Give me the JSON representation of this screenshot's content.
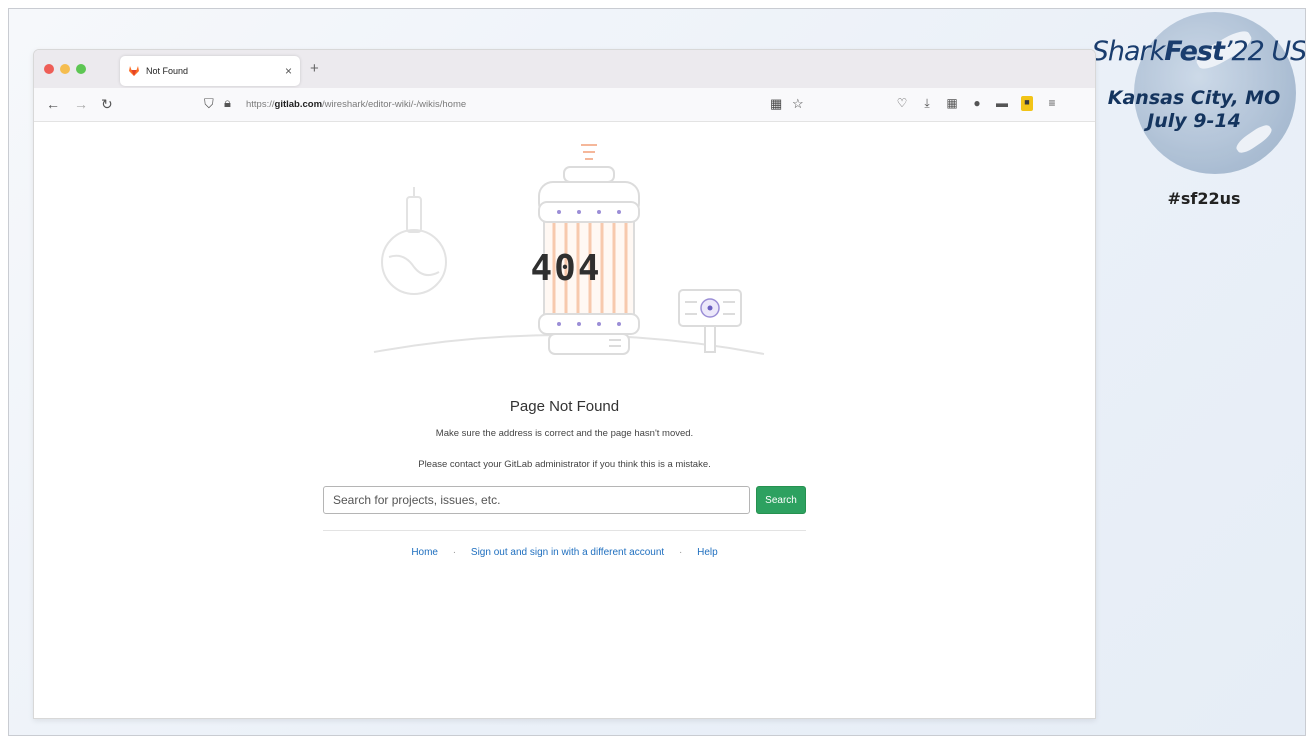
{
  "event": {
    "title_part1": "Shark",
    "title_part2": "Fest",
    "title_part3": "’22 US",
    "city": "Kansas City, MO",
    "dates": "July 9-14",
    "hashtag": "#sf22us"
  },
  "browser": {
    "tab_title": "Not Found",
    "tab_close": "×",
    "new_tab": "+",
    "url_scheme": "https://",
    "url_host": "gitlab.com",
    "url_path": "/wireshark/editor-wiki/-/wikis/home"
  },
  "page": {
    "error_code": "404",
    "title": "Page Not Found",
    "message1": "Make sure the address is correct and the page hasn't moved.",
    "message2": "Please contact your GitLab administrator if you think this is a mistake.",
    "search_placeholder": "Search for projects, issues, etc.",
    "search_button": "Search",
    "links": {
      "home": "Home",
      "sign_out": "Sign out and sign in with a different account",
      "help": "Help",
      "separator": "·"
    }
  },
  "colors": {
    "gitlab_orange": "#fc6d26",
    "search_green": "#2da160",
    "link_blue": "#1f6fbf",
    "illustration_purple": "#9b8ed6"
  }
}
